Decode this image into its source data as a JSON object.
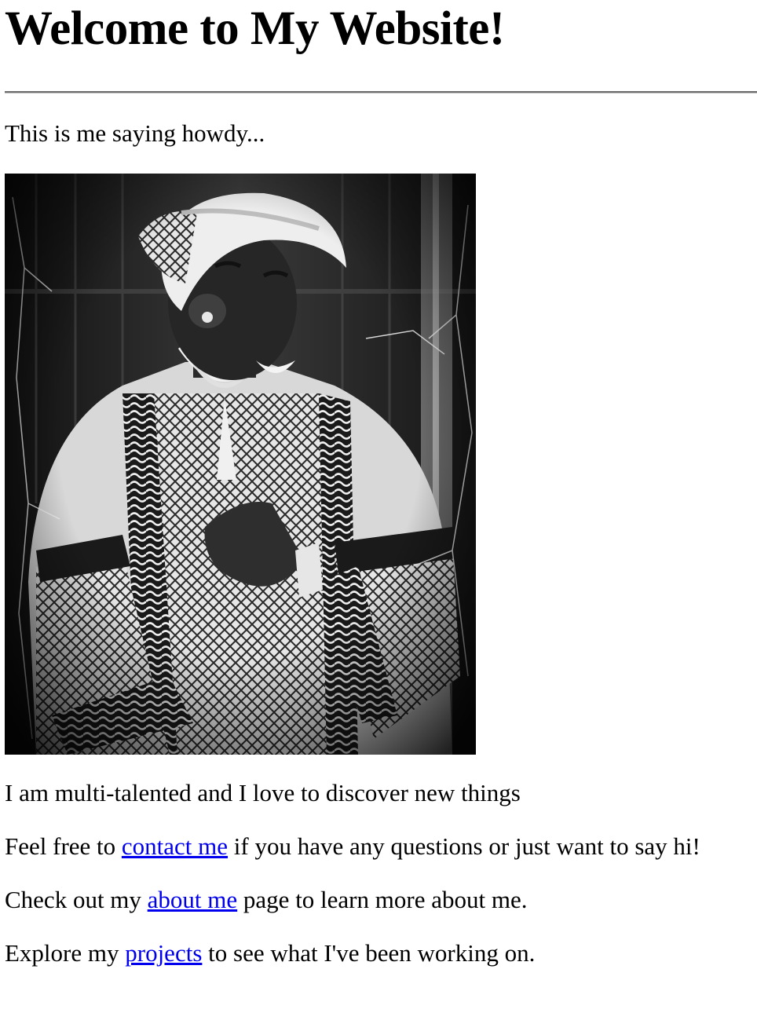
{
  "page": {
    "heading": "Welcome to My Website!",
    "intro": "This is me saying howdy...",
    "photo_alt": "Photo of me",
    "tagline": "I am multi-talented and I love to discover new things",
    "contact": {
      "before": "Feel free to ",
      "link": "contact me",
      "after": " if you have any questions or just want to say hi!"
    },
    "about": {
      "before": "Check out my ",
      "link": "about me",
      "after": " page to learn more about me."
    },
    "projects": {
      "before": "Explore my ",
      "link": "projects",
      "after": " to see what I've been working on."
    }
  },
  "colors": {
    "link": "#0000ee",
    "text": "#000000",
    "background": "#ffffff"
  }
}
